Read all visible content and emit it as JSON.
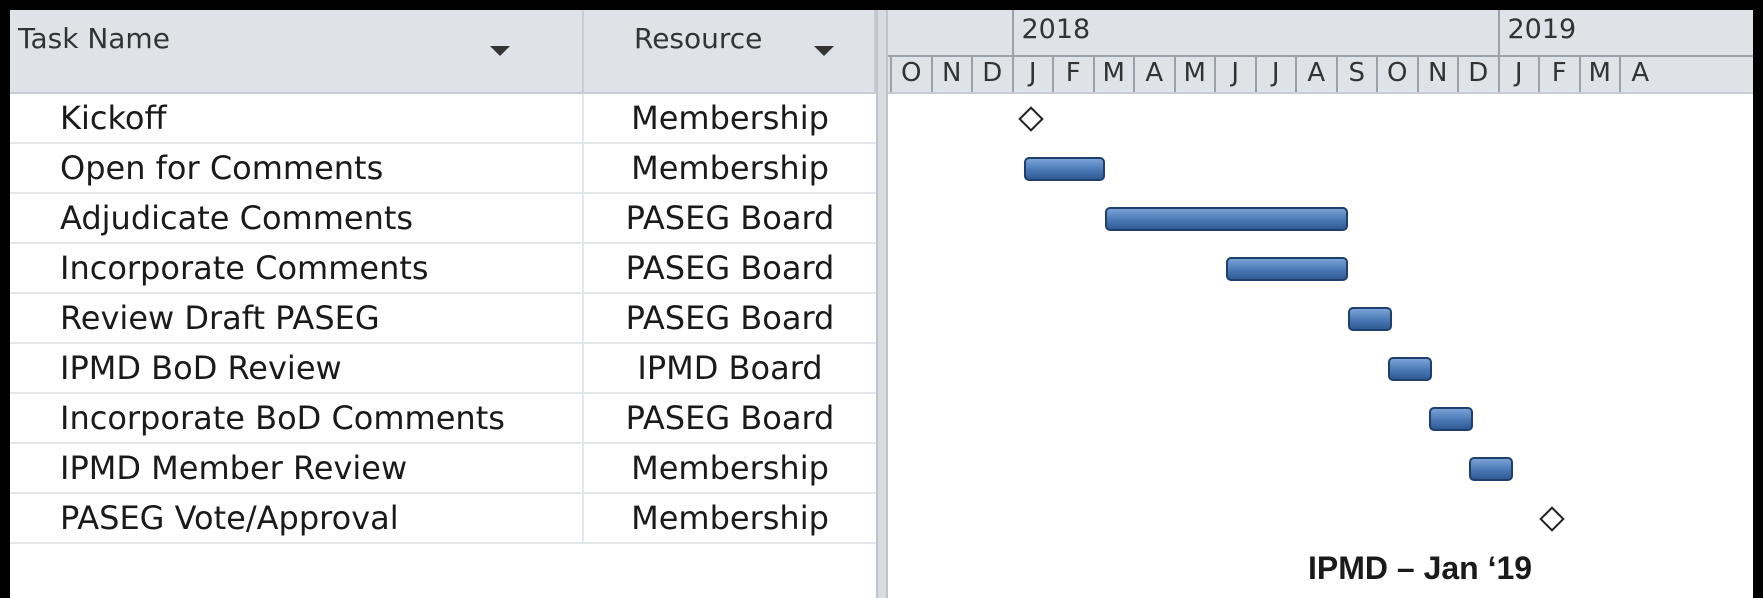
{
  "columns": {
    "task_header": "Task Name",
    "resource_header": "Resource"
  },
  "tasks": [
    {
      "name": "Kickoff",
      "resource": "Membership",
      "type": "milestone",
      "start": "2018-01"
    },
    {
      "name": "Open for Comments",
      "resource": "Membership",
      "type": "task",
      "start": "2018-01",
      "end": "2018-03"
    },
    {
      "name": "Adjudicate Comments",
      "resource": "PASEG Board",
      "type": "task",
      "start": "2018-03",
      "end": "2018-09"
    },
    {
      "name": "Incorporate Comments",
      "resource": "PASEG Board",
      "type": "task",
      "start": "2018-06",
      "end": "2018-09"
    },
    {
      "name": "Review Draft PASEG",
      "resource": "PASEG Board",
      "type": "task",
      "start": "2018-09",
      "end": "2018-10"
    },
    {
      "name": "IPMD BoD Review",
      "resource": "IPMD Board",
      "type": "task",
      "start": "2018-10",
      "end": "2018-11"
    },
    {
      "name": "Incorporate BoD Comments",
      "resource": "PASEG Board",
      "type": "task",
      "start": "2018-11",
      "end": "2018-12"
    },
    {
      "name": "IPMD Member Review",
      "resource": "Membership",
      "type": "task",
      "start": "2018-12",
      "end": "2019-01"
    },
    {
      "name": "PASEG Vote/Approval",
      "resource": "Membership",
      "type": "milestone",
      "start": "2019-01"
    }
  ],
  "timeline": {
    "years": [
      "2018",
      "2019"
    ],
    "months": [
      "O",
      "N",
      "D",
      "J",
      "F",
      "M",
      "A",
      "M",
      "J",
      "J",
      "A",
      "S",
      "O",
      "N",
      "D",
      "J",
      "F",
      "M",
      "A"
    ],
    "first_month": "2017-10"
  },
  "annotation": "IPMD – Jan ‘19",
  "colors": {
    "bar": "#4a78b5",
    "header_bg": "#dfe3e8",
    "frame": "#000000"
  },
  "icons": {
    "dropdown": "caret-down-icon",
    "milestone": "diamond-icon"
  }
}
